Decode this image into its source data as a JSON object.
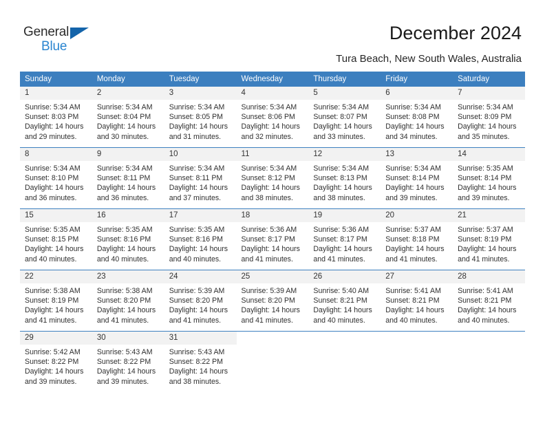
{
  "brand": {
    "name_part1": "General",
    "name_part2": "Blue",
    "accent_color": "#2a85d0",
    "triangle_color": "#1464aa"
  },
  "header": {
    "title": "December 2024",
    "subtitle": "Tura Beach, New South Wales, Australia",
    "header_bg": "#3c7fbf"
  },
  "weekday_headers": [
    "Sunday",
    "Monday",
    "Tuesday",
    "Wednesday",
    "Thursday",
    "Friday",
    "Saturday"
  ],
  "weeks": [
    [
      {
        "day": "1",
        "sunrise": "Sunrise: 5:34 AM",
        "sunset": "Sunset: 8:03 PM",
        "daylight1": "Daylight: 14 hours",
        "daylight2": "and 29 minutes."
      },
      {
        "day": "2",
        "sunrise": "Sunrise: 5:34 AM",
        "sunset": "Sunset: 8:04 PM",
        "daylight1": "Daylight: 14 hours",
        "daylight2": "and 30 minutes."
      },
      {
        "day": "3",
        "sunrise": "Sunrise: 5:34 AM",
        "sunset": "Sunset: 8:05 PM",
        "daylight1": "Daylight: 14 hours",
        "daylight2": "and 31 minutes."
      },
      {
        "day": "4",
        "sunrise": "Sunrise: 5:34 AM",
        "sunset": "Sunset: 8:06 PM",
        "daylight1": "Daylight: 14 hours",
        "daylight2": "and 32 minutes."
      },
      {
        "day": "5",
        "sunrise": "Sunrise: 5:34 AM",
        "sunset": "Sunset: 8:07 PM",
        "daylight1": "Daylight: 14 hours",
        "daylight2": "and 33 minutes."
      },
      {
        "day": "6",
        "sunrise": "Sunrise: 5:34 AM",
        "sunset": "Sunset: 8:08 PM",
        "daylight1": "Daylight: 14 hours",
        "daylight2": "and 34 minutes."
      },
      {
        "day": "7",
        "sunrise": "Sunrise: 5:34 AM",
        "sunset": "Sunset: 8:09 PM",
        "daylight1": "Daylight: 14 hours",
        "daylight2": "and 35 minutes."
      }
    ],
    [
      {
        "day": "8",
        "sunrise": "Sunrise: 5:34 AM",
        "sunset": "Sunset: 8:10 PM",
        "daylight1": "Daylight: 14 hours",
        "daylight2": "and 36 minutes."
      },
      {
        "day": "9",
        "sunrise": "Sunrise: 5:34 AM",
        "sunset": "Sunset: 8:11 PM",
        "daylight1": "Daylight: 14 hours",
        "daylight2": "and 36 minutes."
      },
      {
        "day": "10",
        "sunrise": "Sunrise: 5:34 AM",
        "sunset": "Sunset: 8:11 PM",
        "daylight1": "Daylight: 14 hours",
        "daylight2": "and 37 minutes."
      },
      {
        "day": "11",
        "sunrise": "Sunrise: 5:34 AM",
        "sunset": "Sunset: 8:12 PM",
        "daylight1": "Daylight: 14 hours",
        "daylight2": "and 38 minutes."
      },
      {
        "day": "12",
        "sunrise": "Sunrise: 5:34 AM",
        "sunset": "Sunset: 8:13 PM",
        "daylight1": "Daylight: 14 hours",
        "daylight2": "and 38 minutes."
      },
      {
        "day": "13",
        "sunrise": "Sunrise: 5:34 AM",
        "sunset": "Sunset: 8:14 PM",
        "daylight1": "Daylight: 14 hours",
        "daylight2": "and 39 minutes."
      },
      {
        "day": "14",
        "sunrise": "Sunrise: 5:35 AM",
        "sunset": "Sunset: 8:14 PM",
        "daylight1": "Daylight: 14 hours",
        "daylight2": "and 39 minutes."
      }
    ],
    [
      {
        "day": "15",
        "sunrise": "Sunrise: 5:35 AM",
        "sunset": "Sunset: 8:15 PM",
        "daylight1": "Daylight: 14 hours",
        "daylight2": "and 40 minutes."
      },
      {
        "day": "16",
        "sunrise": "Sunrise: 5:35 AM",
        "sunset": "Sunset: 8:16 PM",
        "daylight1": "Daylight: 14 hours",
        "daylight2": "and 40 minutes."
      },
      {
        "day": "17",
        "sunrise": "Sunrise: 5:35 AM",
        "sunset": "Sunset: 8:16 PM",
        "daylight1": "Daylight: 14 hours",
        "daylight2": "and 40 minutes."
      },
      {
        "day": "18",
        "sunrise": "Sunrise: 5:36 AM",
        "sunset": "Sunset: 8:17 PM",
        "daylight1": "Daylight: 14 hours",
        "daylight2": "and 41 minutes."
      },
      {
        "day": "19",
        "sunrise": "Sunrise: 5:36 AM",
        "sunset": "Sunset: 8:17 PM",
        "daylight1": "Daylight: 14 hours",
        "daylight2": "and 41 minutes."
      },
      {
        "day": "20",
        "sunrise": "Sunrise: 5:37 AM",
        "sunset": "Sunset: 8:18 PM",
        "daylight1": "Daylight: 14 hours",
        "daylight2": "and 41 minutes."
      },
      {
        "day": "21",
        "sunrise": "Sunrise: 5:37 AM",
        "sunset": "Sunset: 8:19 PM",
        "daylight1": "Daylight: 14 hours",
        "daylight2": "and 41 minutes."
      }
    ],
    [
      {
        "day": "22",
        "sunrise": "Sunrise: 5:38 AM",
        "sunset": "Sunset: 8:19 PM",
        "daylight1": "Daylight: 14 hours",
        "daylight2": "and 41 minutes."
      },
      {
        "day": "23",
        "sunrise": "Sunrise: 5:38 AM",
        "sunset": "Sunset: 8:20 PM",
        "daylight1": "Daylight: 14 hours",
        "daylight2": "and 41 minutes."
      },
      {
        "day": "24",
        "sunrise": "Sunrise: 5:39 AM",
        "sunset": "Sunset: 8:20 PM",
        "daylight1": "Daylight: 14 hours",
        "daylight2": "and 41 minutes."
      },
      {
        "day": "25",
        "sunrise": "Sunrise: 5:39 AM",
        "sunset": "Sunset: 8:20 PM",
        "daylight1": "Daylight: 14 hours",
        "daylight2": "and 41 minutes."
      },
      {
        "day": "26",
        "sunrise": "Sunrise: 5:40 AM",
        "sunset": "Sunset: 8:21 PM",
        "daylight1": "Daylight: 14 hours",
        "daylight2": "and 40 minutes."
      },
      {
        "day": "27",
        "sunrise": "Sunrise: 5:41 AM",
        "sunset": "Sunset: 8:21 PM",
        "daylight1": "Daylight: 14 hours",
        "daylight2": "and 40 minutes."
      },
      {
        "day": "28",
        "sunrise": "Sunrise: 5:41 AM",
        "sunset": "Sunset: 8:21 PM",
        "daylight1": "Daylight: 14 hours",
        "daylight2": "and 40 minutes."
      }
    ],
    [
      {
        "day": "29",
        "sunrise": "Sunrise: 5:42 AM",
        "sunset": "Sunset: 8:22 PM",
        "daylight1": "Daylight: 14 hours",
        "daylight2": "and 39 minutes."
      },
      {
        "day": "30",
        "sunrise": "Sunrise: 5:43 AM",
        "sunset": "Sunset: 8:22 PM",
        "daylight1": "Daylight: 14 hours",
        "daylight2": "and 39 minutes."
      },
      {
        "day": "31",
        "sunrise": "Sunrise: 5:43 AM",
        "sunset": "Sunset: 8:22 PM",
        "daylight1": "Daylight: 14 hours",
        "daylight2": "and 38 minutes."
      },
      {
        "day": "",
        "sunrise": "",
        "sunset": "",
        "daylight1": "",
        "daylight2": ""
      },
      {
        "day": "",
        "sunrise": "",
        "sunset": "",
        "daylight1": "",
        "daylight2": ""
      },
      {
        "day": "",
        "sunrise": "",
        "sunset": "",
        "daylight1": "",
        "daylight2": ""
      },
      {
        "day": "",
        "sunrise": "",
        "sunset": "",
        "daylight1": "",
        "daylight2": ""
      }
    ]
  ]
}
